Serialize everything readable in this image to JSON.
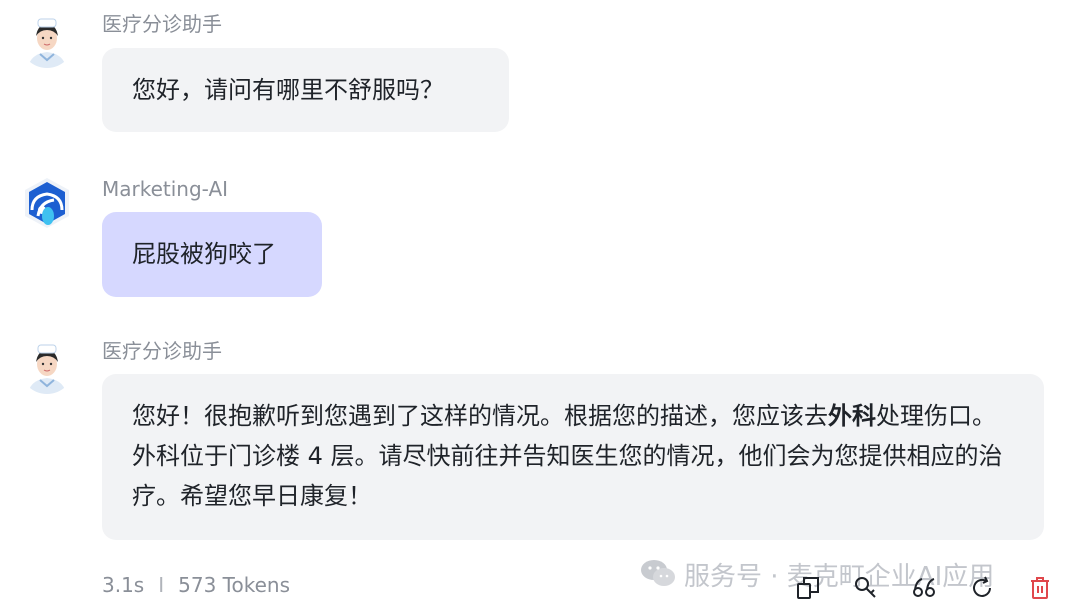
{
  "messages": [
    {
      "sender": "医疗分诊助手",
      "role": "assistant",
      "text": "您好，请问有哪里不舒服吗？"
    },
    {
      "sender": "Marketing-AI",
      "role": "user",
      "text": "屁股被狗咬了"
    },
    {
      "sender": "医疗分诊助手",
      "role": "assistant",
      "text_before": "您好！很抱歉听到您遇到了这样的情况。根据您的描述，您应该去",
      "text_bold": "外科",
      "text_after": "处理伤口。外科位于门诊楼 4 层。请尽快前往并告知医生您的情况，他们会为您提供相应的治疗。希望您早日康复！"
    }
  ],
  "meta": {
    "time": "3.1s",
    "separator": "I",
    "tokens": "573 Tokens"
  },
  "watermark": "服务号 · 麦克町企业AI应用",
  "toolbar": {
    "icons": [
      "copy-icon",
      "edit-icon",
      "quote-icon",
      "refresh-icon",
      "delete-icon"
    ],
    "delete_color": "#e0474c"
  },
  "colors": {
    "assistant_bubble": "#f2f3f5",
    "user_bubble": "#d6d8ff",
    "brand_blue": "#1d5fd1"
  }
}
